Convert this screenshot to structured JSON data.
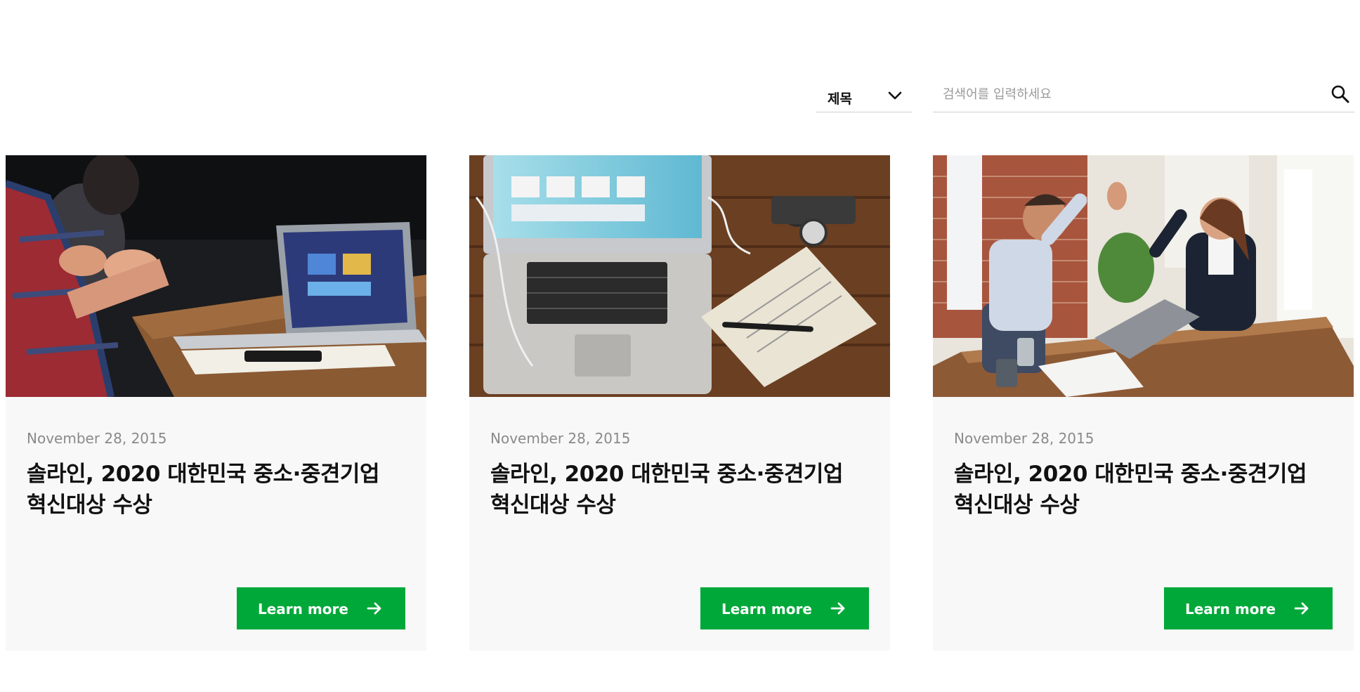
{
  "filter": {
    "selected": "제목",
    "icon": "chevron-down-icon"
  },
  "search": {
    "placeholder": "검색어를 입력하세요",
    "value": "",
    "icon": "search-icon"
  },
  "theme": {
    "accent": "#00a839",
    "card_background": "#f8f8f8"
  },
  "cards": [
    {
      "image": "team-meeting-laptop-photo",
      "date": "November 28, 2015",
      "title": "솔라인, 2020 대한민국 중소·중견기업 혁신대상 수상",
      "button_label": "Learn more",
      "button_icon": "arrow-right-icon"
    },
    {
      "image": "laptop-notebook-desk-photo",
      "date": "November 28, 2015",
      "title": "솔라인, 2020 대한민국 중소·중견기업 혁신대상 수상",
      "button_label": "Learn more",
      "button_icon": "arrow-right-icon"
    },
    {
      "image": "colleagues-high-five-photo",
      "date": "November 28, 2015",
      "title": "솔라인, 2020 대한민국 중소·중견기업 혁신대상 수상",
      "button_label": "Learn more",
      "button_icon": "arrow-right-icon"
    }
  ]
}
